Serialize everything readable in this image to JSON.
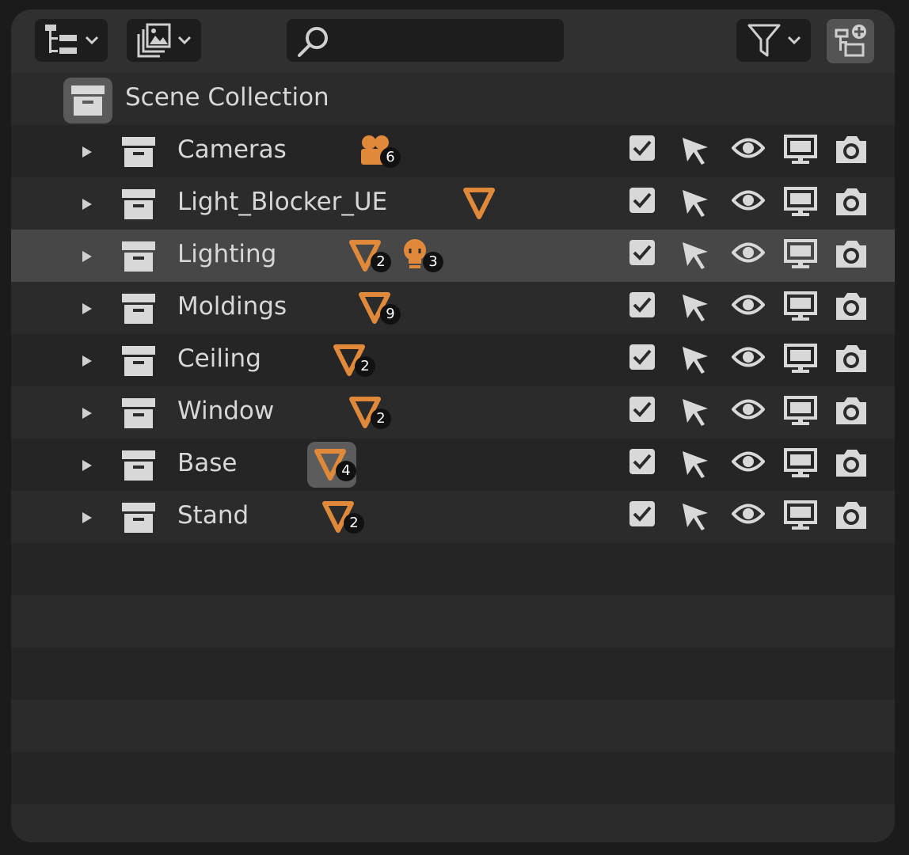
{
  "header": {
    "display_mode_icon": "outliner-tree-icon",
    "filter_type_icon": "image-stack-icon",
    "search": {
      "value": "",
      "placeholder": ""
    },
    "filter_icon": "funnel-icon",
    "new_collection_icon": "new-collection-icon"
  },
  "scene_collection": {
    "label": "Scene Collection"
  },
  "collections": [
    {
      "label": "Cameras",
      "badges": [
        {
          "icon": "camera-object-icon",
          "count": "6"
        }
      ]
    },
    {
      "label": "Light_Blocker_UE",
      "badges": [
        {
          "icon": "mesh-object-icon",
          "count": ""
        }
      ]
    },
    {
      "label": "Lighting",
      "selected": true,
      "badges": [
        {
          "icon": "mesh-object-icon",
          "count": "2"
        },
        {
          "icon": "light-object-icon",
          "count": "3"
        }
      ]
    },
    {
      "label": "Moldings",
      "badges": [
        {
          "icon": "mesh-object-icon",
          "count": "9"
        }
      ]
    },
    {
      "label": "Ceiling",
      "badges": [
        {
          "icon": "mesh-object-icon",
          "count": "2"
        }
      ]
    },
    {
      "label": "Window",
      "badges": [
        {
          "icon": "mesh-object-icon",
          "count": "2"
        }
      ]
    },
    {
      "label": "Base",
      "badges": [
        {
          "icon": "mesh-object-icon",
          "count": "4",
          "highlighted": true
        }
      ]
    },
    {
      "label": "Stand",
      "badges": [
        {
          "icon": "mesh-object-icon",
          "count": "2"
        }
      ]
    }
  ],
  "row_toggles": [
    "checkbox-icon",
    "select-arrow-icon",
    "eye-icon",
    "monitor-icon",
    "camera-render-icon"
  ],
  "colors": {
    "accent_orange": "#e0893a",
    "panel_bg": "#282828",
    "header_bg": "#303030",
    "selected_row": "#474747"
  }
}
